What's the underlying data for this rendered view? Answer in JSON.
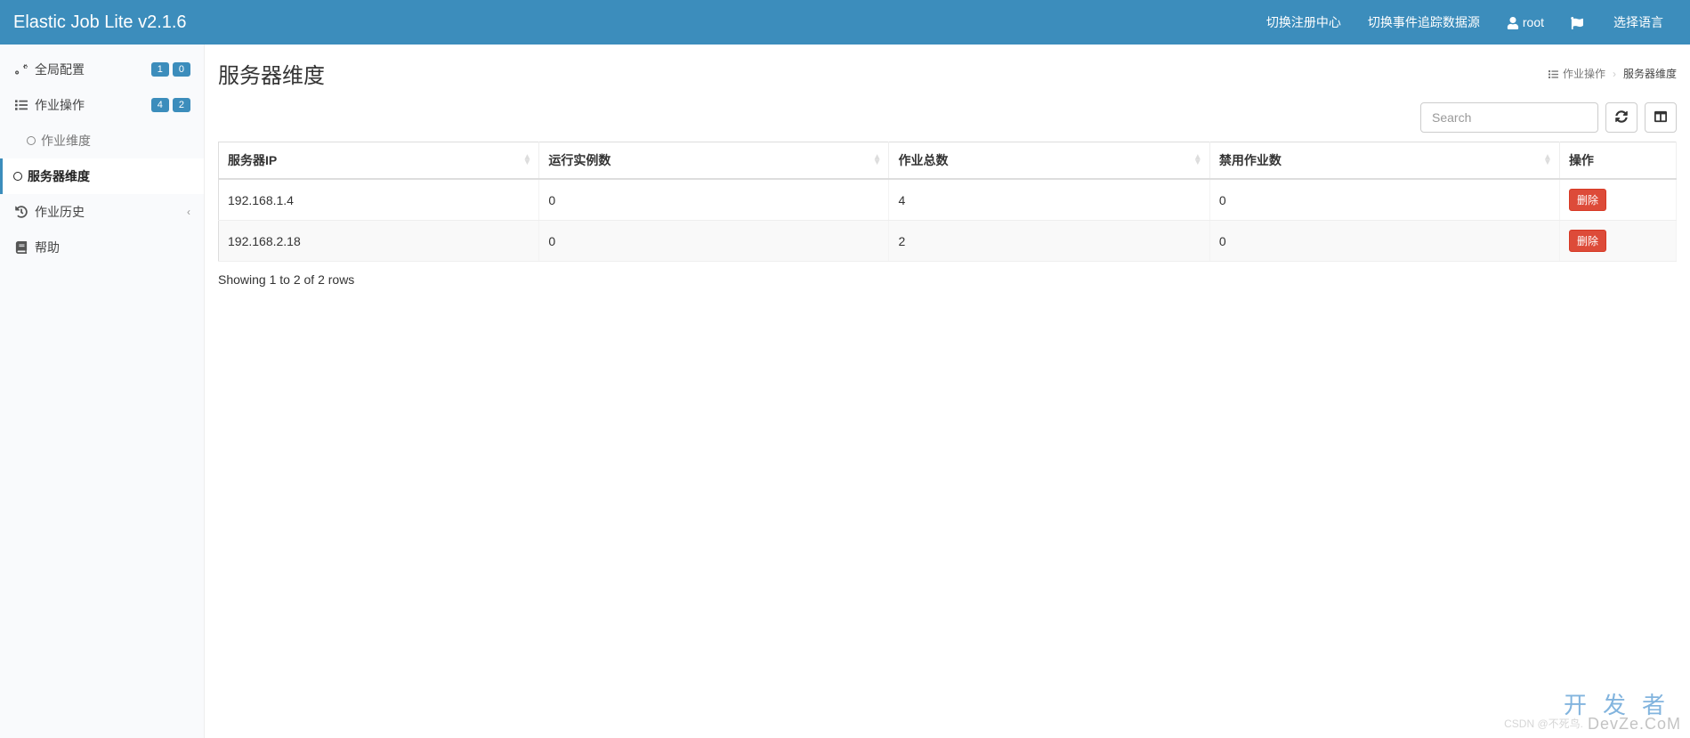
{
  "header": {
    "logo": "Elastic Job Lite v2.1.6",
    "nav": {
      "switch_registry": "切换注册中心",
      "switch_event_source": "切换事件追踪数据源",
      "user": "root",
      "language": "选择语言"
    }
  },
  "sidebar": {
    "global_config": {
      "label": "全局配置",
      "badges": [
        "1",
        "0"
      ]
    },
    "job_ops": {
      "label": "作业操作",
      "badges": [
        "4",
        "2"
      ]
    },
    "job_dim": {
      "label": "作业维度"
    },
    "server_dim": {
      "label": "服务器维度"
    },
    "job_history": {
      "label": "作业历史"
    },
    "help": {
      "label": "帮助"
    }
  },
  "page": {
    "title": "服务器维度",
    "breadcrumb": {
      "parent": "作业操作",
      "current": "服务器维度"
    }
  },
  "toolbar": {
    "search_placeholder": "Search"
  },
  "table": {
    "columns": {
      "server_ip": "服务器IP",
      "running_instances": "运行实例数",
      "total_jobs": "作业总数",
      "disabled_jobs": "禁用作业数",
      "actions": "操作"
    },
    "rows": [
      {
        "server_ip": "192.168.1.4",
        "running_instances": "0",
        "total_jobs": "4",
        "disabled_jobs": "0",
        "action_label": "删除"
      },
      {
        "server_ip": "192.168.2.18",
        "running_instances": "0",
        "total_jobs": "2",
        "disabled_jobs": "0",
        "action_label": "删除"
      }
    ],
    "pagination_info": "Showing 1 to 2 of 2 rows"
  },
  "watermark": {
    "line1": "开发者",
    "line2": "DevZe.CoM",
    "line3": "CSDN @不死鸟."
  }
}
